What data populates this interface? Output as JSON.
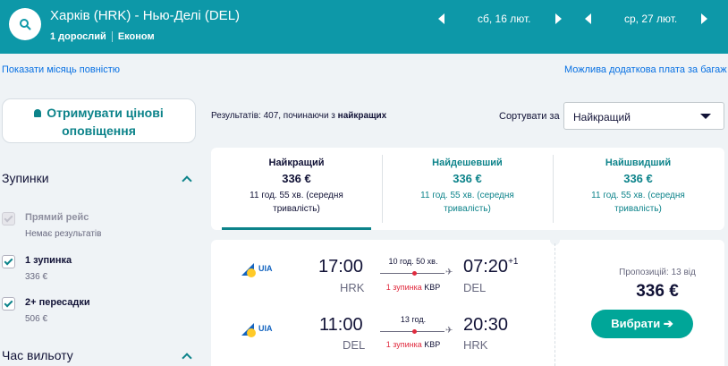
{
  "header": {
    "route": "Харків (HRK) - Нью-Делі (DEL)",
    "passengers": "1 дорослий",
    "cabin": "Економ",
    "depart_date": "сб, 16 лют.",
    "return_date": "ср, 27 лют."
  },
  "links": {
    "show_month": "Показати місяць повністю",
    "baggage_fee": "Можлива додаткова плата за багаж"
  },
  "sidebar": {
    "alert_label": "Отримувати цінові оповіщення",
    "stops_title": "Зупинки",
    "filters": [
      {
        "label": "Прямий рейс",
        "sub": "Немає результатів",
        "checked": true,
        "disabled": true
      },
      {
        "label": "1 зупинка",
        "sub": "336 €",
        "checked": true,
        "disabled": false
      },
      {
        "label": "2+ пересадки",
        "sub": "506 €",
        "checked": true,
        "disabled": false
      }
    ],
    "departure_title": "Час вильоту"
  },
  "results": {
    "prefix": "Результатів: 407, починаючи з ",
    "emph": "найкращих",
    "sort_label": "Сортувати за",
    "sort_value": "Найкращий"
  },
  "tabs": [
    {
      "title": "Найкращий",
      "price": "336 €",
      "duration": "11 год. 55 хв. (середня тривалість)"
    },
    {
      "title": "Найдешевший",
      "price": "336 €",
      "duration": "11 год. 55 хв. (середня тривалість)"
    },
    {
      "title": "Найшвидший",
      "price": "336 €",
      "duration": "11 год. 55 хв. (середня тривалість)"
    }
  ],
  "card": {
    "legs": [
      {
        "airline": "UIA",
        "dep_time": "17:00",
        "dep_code": "HRK",
        "duration": "10 год. 50 хв.",
        "stops": "1 зупинка",
        "via": "KBP",
        "arr_time": "07:20",
        "day_offset": "+1",
        "arr_code": "DEL"
      },
      {
        "airline": "UIA",
        "dep_time": "11:00",
        "dep_code": "DEL",
        "duration": "13 год.",
        "stops": "1 зупинка",
        "via": "KBP",
        "arr_time": "20:30",
        "day_offset": "",
        "arr_code": "HRK"
      }
    ],
    "offers": "Пропозицій: 13 від",
    "price": "336 €",
    "select_label": "Вибрати",
    "select_arrow": "➔"
  },
  "colors": {
    "header_bg": "#0d98a8",
    "accent": "#0c838a",
    "button": "#00a698",
    "stop_red": "#e02a3e"
  },
  "icons": [
    "search-icon",
    "chevron-left-icon",
    "chevron-right-icon",
    "bell-icon",
    "chevron-up-icon",
    "check-icon",
    "plane-icon",
    "arrow-right-icon",
    "caret-down-icon"
  ]
}
